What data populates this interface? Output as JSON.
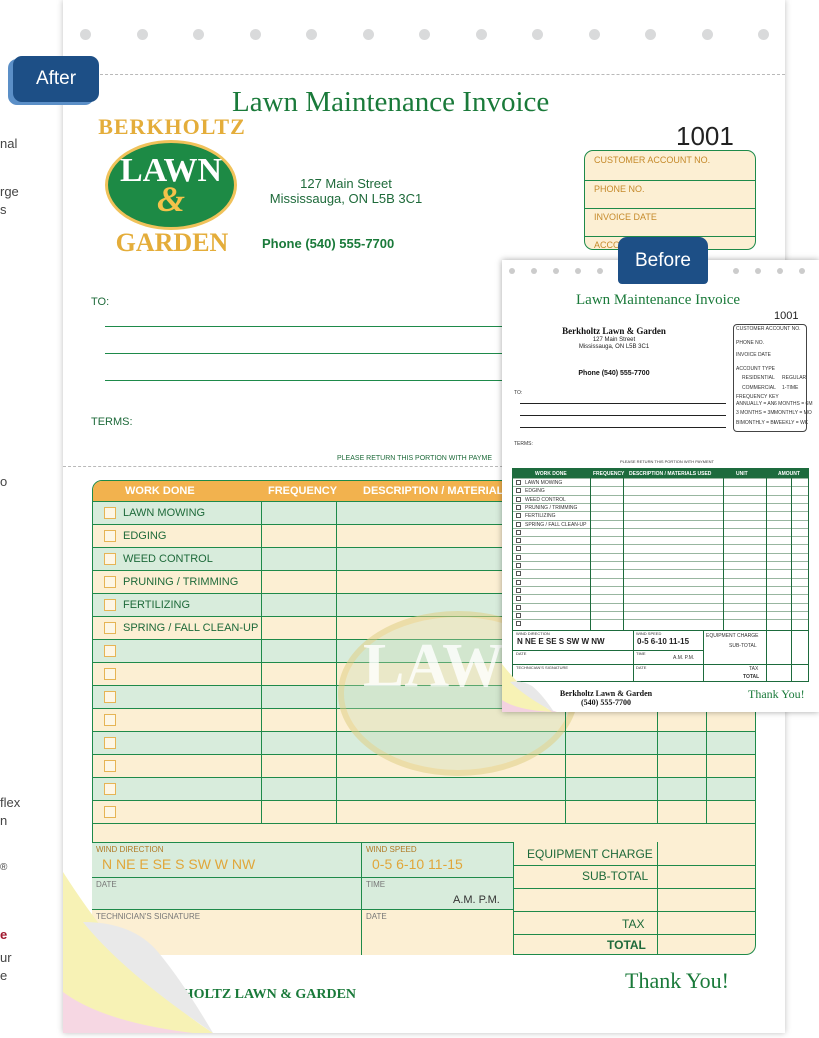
{
  "side_fragments": [
    "nal",
    "rge",
    "s",
    "o",
    "flex",
    "n",
    "®",
    "e",
    "ur",
    "e"
  ],
  "badge_after": "After",
  "badge_before": "Before",
  "invoice": {
    "title": "Lawn Maintenance Invoice",
    "number": "1001",
    "logo": {
      "top": "BERKHOLTZ",
      "middle": "LAWN",
      "amp": "&",
      "bottom": "GARDEN"
    },
    "address1": "127 Main Street",
    "address2": "Mississauga, ON L5B 3C1",
    "phone": "Phone (540) 555-7700",
    "to_label": "TO:",
    "terms_label": "TERMS:",
    "return_note": "PLEASE RETURN THIS PORTION WITH PAYME",
    "account_fields": [
      "CUSTOMER ACCOUNT NO.",
      "PHONE NO.",
      "INVOICE DATE",
      "ACCO"
    ],
    "headers": [
      "WORK DONE",
      "FREQUENCY",
      "DESCRIPTION / MATERIAL"
    ],
    "work_items": [
      "LAWN MOWING",
      "EDGING",
      "WEED CONTROL",
      "PRUNING / TRIMMING",
      "FERTILIZING",
      "SPRING / FALL CLEAN-UP"
    ],
    "wind_direction_label": "WIND DIRECTION",
    "wind_directions": "N   NE   E   SE   S   SW   W   NW",
    "wind_speed_label": "WIND SPEED",
    "wind_speeds": "0-5    6-10    11-15",
    "date_label": "DATE",
    "time_label": "TIME",
    "am_pm": "A.M.   P.M.",
    "tech_label": "TECHNICIAN'S SIGNATURE",
    "date_label2": "DATE",
    "equipment_charge": "EQUIPMENT CHARGE",
    "subtotal": "SUB-TOTAL",
    "tax": "TAX",
    "total": "TOTAL",
    "footer_company": "BERKHOLTZ LAWN & GARDEN",
    "thank_you": "Thank You!"
  },
  "before_form": {
    "title": "Lawn Maintenance Invoice",
    "number": "1001",
    "company": "Berkholtz Lawn & Garden",
    "address1": "127 Main Street",
    "address2": "Mississauga, ON L5B 3C1",
    "phone": "Phone (540) 555-7700",
    "to_label": "TO:",
    "terms_label": "TERMS:",
    "return_note": "PLEASE RETURN THIS PORTION WITH PAYMENT",
    "account_fields": [
      "CUSTOMER ACCOUNT NO.",
      "PHONE NO.",
      "INVOICE DATE",
      "ACCOUNT TYPE"
    ],
    "account_types": [
      "RESIDENTIAL",
      "REGULAR",
      "COMMERCIAL",
      "1-TIME"
    ],
    "frequency_key_label": "FREQUENCY KEY",
    "frequency_key": [
      "ANNUALLY = AN",
      "6 MONTHS = 6M",
      "3 MONTHS = 3M",
      "MONTHLY = MO",
      "BIMONTHLY = BI",
      "WEEKLY = WK"
    ],
    "headers": [
      "WORK DONE",
      "FREQUENCY",
      "DESCRIPTION / MATERIALS USED",
      "UNIT",
      "AMOUNT"
    ],
    "work_items": [
      "LAWN MOWING",
      "EDGING",
      "WEED CONTROL",
      "PRUNING / TRIMMING",
      "FERTILIZING",
      "SPRING / FALL CLEAN-UP"
    ],
    "wind_directions": "N  NE  E  SE  S  SW  W  NW",
    "wind_speeds": "0-5   6-10   11-15",
    "wind_direction_label": "WIND DIRECTION",
    "wind_speed_label": "WIND SPEED",
    "date_label": "DATE",
    "time_label": "TIME",
    "am_pm": "A.M.   P.M.",
    "tech_label": "TECHNICIAN'S SIGNATURE",
    "date_label2": "DATE",
    "equipment_charge": "EQUIPMENT CHARGE",
    "subtotal": "SUB-TOTAL",
    "tax": "TAX",
    "total": "TOTAL",
    "footer_company": "Berkholtz Lawn & Garden",
    "footer_phone": "(540) 555-7700",
    "thank_you": "Thank You!"
  }
}
